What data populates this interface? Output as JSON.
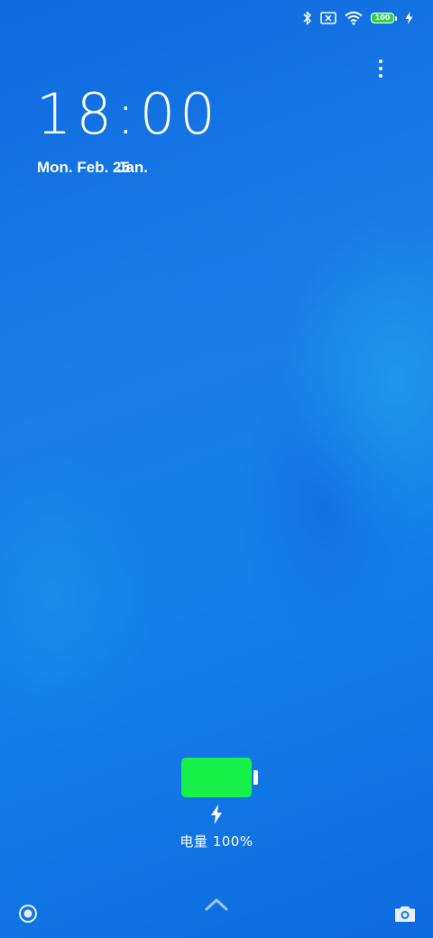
{
  "status_bar": {
    "icons": [
      "bluetooth-icon",
      "no-sim-icon",
      "wifi-icon",
      "battery-icon",
      "charging-icon"
    ],
    "battery_level": "100",
    "battery_color": "#2fd24a"
  },
  "lockscreen": {
    "time": "18:00",
    "date": "Mon. Feb. 25",
    "date_overlap": "Jan."
  },
  "charging": {
    "label": "电量 100%",
    "level": 1.0,
    "battery_color": "#16f24a"
  },
  "bottom_bar": {
    "left_icon": "target-circle-icon",
    "center_icon": "chevron-up-icon",
    "right_icon": "camera-icon"
  },
  "colors": {
    "wallpaper": "#1673e0"
  }
}
